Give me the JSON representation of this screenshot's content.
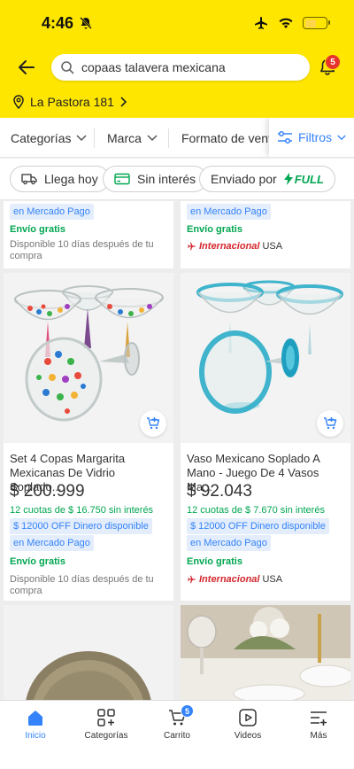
{
  "status": {
    "time": "4:46"
  },
  "header": {
    "search_text": "copaas talavera mexicana",
    "notification_count": "5",
    "location": "La Pastora 181"
  },
  "filters": {
    "items": [
      "Categorías",
      "Marca",
      "Formato de venta"
    ],
    "filtros_label": "Filtros"
  },
  "chips": {
    "llega_hoy": "Llega hoy",
    "sin_interes": "Sin interés",
    "enviado_por": "Enviado por",
    "full": "FULL"
  },
  "top_partial": [
    {
      "promo": "en Mercado Pago",
      "envio": "Envío gratis",
      "disponible": "Disponible 10 días después de tu compra"
    },
    {
      "promo": "en Mercado Pago",
      "envio": "Envío gratis",
      "internacional": "Internacional",
      "country": "USA"
    }
  ],
  "products": [
    {
      "title": "Set 4 Copas Margarita Mexicanas De Vidrio Soplado...",
      "price": "$ 200.999",
      "installments": "12 cuotas de $ 16.750 sin interés",
      "promo_line1": "$ 12000 OFF Dinero disponible",
      "promo_line2": "en Mercado Pago",
      "envio": "Envío gratis",
      "disponible": "Disponible 10 días después de tu compra"
    },
    {
      "title": "Vaso Mexicano Soplado A Mano - Juego De 4 Vasos Ma...",
      "price": "$ 92.043",
      "installments": "12 cuotas de $ 7.670 sin interés",
      "promo_line1": "$ 12000 OFF Dinero disponible",
      "promo_line2": "en Mercado Pago",
      "envio": "Envío gratis",
      "internacional": "Internacional",
      "country": "USA"
    }
  ],
  "tabbar": {
    "items": [
      {
        "label": "Inicio",
        "icon": "home-icon",
        "active": true
      },
      {
        "label": "Categorías",
        "icon": "categories-icon"
      },
      {
        "label": "Carrito",
        "icon": "cart-icon"
      },
      {
        "label": "Videos",
        "icon": "video-icon"
      },
      {
        "label": "Más",
        "icon": "menu-icon"
      }
    ],
    "cart_count": "5"
  },
  "colors": {
    "brand_yellow": "#ffe600",
    "accent_blue": "#3483fa",
    "green": "#00a650",
    "badge_red": "#e8352b"
  }
}
